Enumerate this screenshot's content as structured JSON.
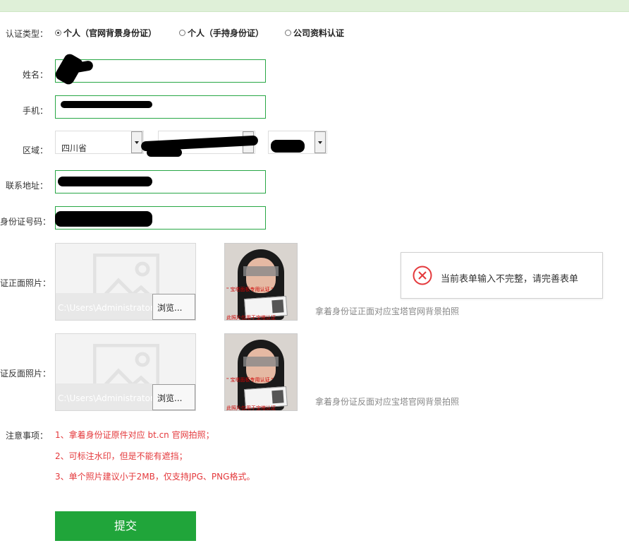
{
  "form": {
    "cert_type_label": "认证类型：",
    "cert_options": [
      {
        "label": "个人（官网背景身份证）",
        "checked": true
      },
      {
        "label": "个人（手持身份证）",
        "checked": false
      },
      {
        "label": "公司资料认证",
        "checked": false
      }
    ],
    "name_label": "姓名：",
    "phone_label": "手机：",
    "region_label": "区域：",
    "province_value": "四川省",
    "address_label": "联系地址：",
    "idnumber_label": "身份证号码：",
    "front_photo_label": "证正面照片：",
    "back_photo_label": "证反面照片：",
    "file_path": "C:\\Users\\Administrator",
    "browse_label": "浏览...",
    "front_hint": "拿着身份证正面对应宝塔官网背景拍照",
    "back_hint": "拿着身份证反面对应宝塔官网背景拍照",
    "notes_label": "注意事项：",
    "notes": [
      "1、拿着身份证原件对应 bt.cn 官网拍照；",
      "2、可标注水印，但是不能有遮挡；",
      "3、单个照片建议小于2MB，仅支持JPG、PNG格式。"
    ],
    "submit_label": "提交"
  },
  "toast": {
    "message": "当前表单输入不完整，请完善表单",
    "icon": "error-circle-icon"
  },
  "colors": {
    "accent": "#20a53a",
    "field_border": "#28a745",
    "note": "#e4393c",
    "topbar": "#dff0d8"
  }
}
